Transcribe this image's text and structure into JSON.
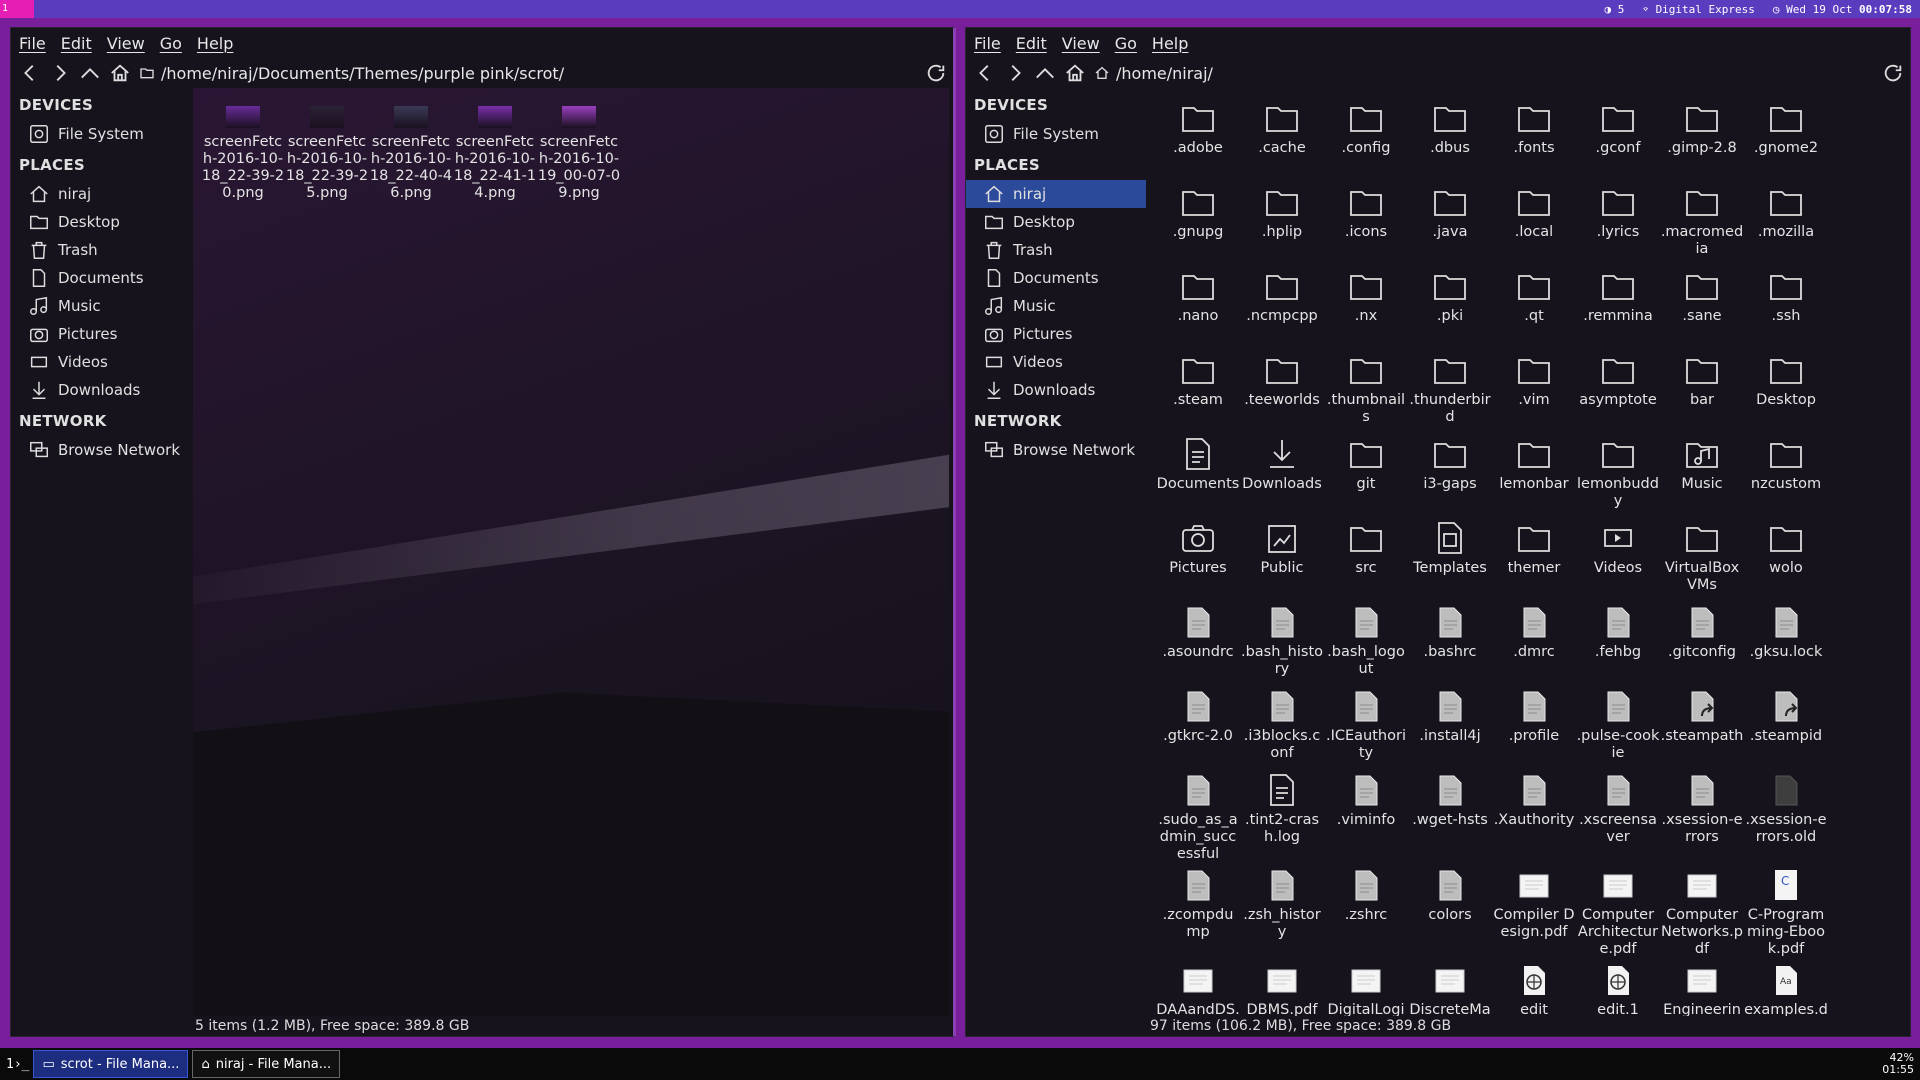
{
  "topbar": {
    "workspace": "1",
    "cpu": "5",
    "wifi": "Digital Express",
    "date": "Wed 19 Oct",
    "time": "00:07:58"
  },
  "menu": [
    "File",
    "Edit",
    "View",
    "Go",
    "Help"
  ],
  "left": {
    "path": "/home/niraj/Documents/Themes/purple pink/scrot/",
    "status": "5 items (1.2 MB), Free space: 389.8 GB",
    "files": [
      "screenFetch-2016-10-18_22-39-20.png",
      "screenFetch-2016-10-18_22-39-25.png",
      "screenFetch-2016-10-18_22-40-46.png",
      "screenFetch-2016-10-18_22-41-14.png",
      "screenFetch-2016-10-19_00-07-09.png"
    ]
  },
  "right": {
    "path": "/home/niraj/",
    "status": "97 items (106.2 MB), Free space: 389.8 GB"
  },
  "sidebar": {
    "devices": "DEVICES",
    "filesystem": "File System",
    "places": "PLACES",
    "network": "NETWORK",
    "browse": "Browse Network",
    "items": [
      "niraj",
      "Desktop",
      "Trash",
      "Documents",
      "Music",
      "Pictures",
      "Videos",
      "Downloads"
    ]
  },
  "grid": [
    [
      [
        "folder",
        ".adobe"
      ],
      [
        "folder",
        ".cache"
      ],
      [
        "folder",
        ".config"
      ],
      [
        "folder",
        ".dbus"
      ],
      [
        "folder",
        ".fonts"
      ],
      [
        "folder",
        ".gconf"
      ],
      [
        "folder",
        ".gimp-2.8"
      ],
      [
        "folder",
        ".gnome2"
      ]
    ],
    [
      [
        "folder",
        ".gnupg"
      ],
      [
        "folder",
        ".hplip"
      ],
      [
        "folder",
        ".icons"
      ],
      [
        "folder",
        ".java"
      ],
      [
        "folder",
        ".local"
      ],
      [
        "folder",
        ".lyrics"
      ],
      [
        "folder",
        ".macromedia"
      ],
      [
        "folder",
        ".mozilla"
      ]
    ],
    [
      [
        "folder",
        ".nano"
      ],
      [
        "folder",
        ".ncmpcpp"
      ],
      [
        "folder",
        ".nx"
      ],
      [
        "folder",
        ".pki"
      ],
      [
        "folder",
        ".qt"
      ],
      [
        "folder",
        ".remmina"
      ],
      [
        "folder",
        ".sane"
      ],
      [
        "folder",
        ".ssh"
      ]
    ],
    [
      [
        "folder",
        ".steam"
      ],
      [
        "folder",
        ".teeworlds"
      ],
      [
        "folder",
        ".thumbnails"
      ],
      [
        "folder",
        ".thunderbird"
      ],
      [
        "folder",
        ".vim"
      ],
      [
        "folder",
        "asymptote"
      ],
      [
        "folder",
        "bar"
      ],
      [
        "folder",
        "Desktop"
      ]
    ],
    [
      [
        "doc",
        "Documents"
      ],
      [
        "download",
        "Downloads"
      ],
      [
        "folder",
        "git"
      ],
      [
        "folder",
        "i3-gaps"
      ],
      [
        "folder",
        "lemonbar"
      ],
      [
        "folder",
        "lemonbuddy"
      ],
      [
        "music",
        "Music"
      ],
      [
        "folder",
        "nzcustom"
      ]
    ],
    [
      [
        "camera",
        "Pictures"
      ],
      [
        "public",
        "Public"
      ],
      [
        "folder",
        "src"
      ],
      [
        "template",
        "Templates"
      ],
      [
        "folder",
        "themer"
      ],
      [
        "video",
        "Videos"
      ],
      [
        "folder",
        "VirtualBox VMs"
      ],
      [
        "folder",
        "wolo"
      ]
    ],
    [
      [
        "file",
        ".asoundrc"
      ],
      [
        "file",
        ".bash_history"
      ],
      [
        "file",
        ".bash_logout"
      ],
      [
        "file",
        ".bashrc"
      ],
      [
        "file",
        ".dmrc"
      ],
      [
        "file",
        ".fehbg"
      ],
      [
        "file",
        ".gitconfig"
      ],
      [
        "file",
        ".gksu.lock"
      ]
    ],
    [
      [
        "file",
        ".gtkrc-2.0"
      ],
      [
        "file",
        ".i3blocks.conf"
      ],
      [
        "file",
        ".ICEauthority"
      ],
      [
        "file",
        ".install4j"
      ],
      [
        "file",
        ".profile"
      ],
      [
        "file",
        ".pulse-cookie"
      ],
      [
        "link",
        ".steampath"
      ],
      [
        "link",
        ".steampid"
      ]
    ],
    [
      [
        "file",
        ".sudo_as_admin_successful"
      ],
      [
        "doc",
        ".tint2-crash.log"
      ],
      [
        "file",
        ".viminfo"
      ],
      [
        "file",
        ".wget-hsts"
      ],
      [
        "file",
        ".Xauthority"
      ],
      [
        "file",
        ".xscreensaver"
      ],
      [
        "file",
        ".xsession-errors"
      ],
      [
        "dark",
        ".xsession-errors.old"
      ]
    ],
    [
      [
        "file",
        ".zcompdump"
      ],
      [
        "file",
        ".zsh_history"
      ],
      [
        "file",
        ".zshrc"
      ],
      [
        "file",
        "colors"
      ],
      [
        "pdf",
        "Compiler Design.pdf"
      ],
      [
        "pdf",
        "Computer Architecture.pdf"
      ],
      [
        "pdf",
        "Computer Networks.pdf"
      ],
      [
        "cpdf",
        "C-Programming-Ebook.pdf"
      ]
    ],
    [
      [
        "pdf",
        "DAAandDS.pdf"
      ],
      [
        "pdf",
        "DBMS.pdf"
      ],
      [
        "pdf",
        "DigitalLogic.pdf"
      ],
      [
        "pdf",
        "DiscreteMathematics"
      ],
      [
        "web",
        "edit"
      ],
      [
        "web",
        "edit.1"
      ],
      [
        "pdf",
        "EngineeringMaths"
      ],
      [
        "text",
        "examples.desktop"
      ]
    ]
  ],
  "taskbar": {
    "term": "1›_",
    "task1": "scrot - File Mana...",
    "task2": "niraj - File Mana...",
    "battery": "42%",
    "clock": "01:55"
  },
  "colors": {
    "accent": "#7a1f9c",
    "selection": "#2b4b9a",
    "topbar": "#5a3dbf"
  }
}
